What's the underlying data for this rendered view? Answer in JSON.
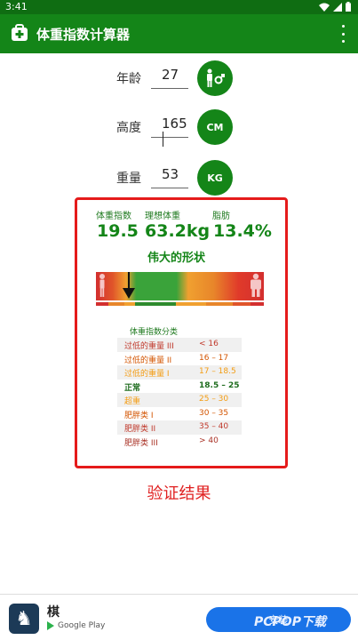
{
  "status_bar": {
    "time": "3:41"
  },
  "app_bar": {
    "title": "体重指数计算器"
  },
  "inputs": {
    "age": {
      "label": "年龄",
      "value": "27",
      "button_icon": "gender-icon"
    },
    "height": {
      "label": "高度",
      "value": "165",
      "unit": "CM"
    },
    "weight": {
      "label": "重量",
      "value": "53",
      "unit": "KG"
    }
  },
  "result": {
    "labels": {
      "bmi": "体重指数",
      "ideal": "理想体重",
      "fat": "脂肪"
    },
    "values": {
      "bmi": "19.5",
      "ideal": "63.2kg",
      "fat": "13.4%"
    },
    "subtitle": "伟大的形状",
    "category_title": "体重指数分类",
    "categories": [
      {
        "name": "过低的重量 III",
        "range": "< 16",
        "color": "#c0392b"
      },
      {
        "name": "过低的重量 II",
        "range": "16 – 17",
        "color": "#d35400"
      },
      {
        "name": "过低的重量 I",
        "range": "17 – 18.5",
        "color": "#f39c12"
      },
      {
        "name": "正常",
        "range": "18.5 – 25",
        "color": "#1f6d1f"
      },
      {
        "name": "超重",
        "range": "25 – 30",
        "color": "#f39c12"
      },
      {
        "name": "肥胖类 I",
        "range": "30 – 35",
        "color": "#d35400"
      },
      {
        "name": "肥胖类 II",
        "range": "35 – 40",
        "color": "#c0392b"
      },
      {
        "name": "肥胖类 III",
        "range": "> 40",
        "color": "#a93226"
      }
    ]
  },
  "caption": "验证结果",
  "ad": {
    "app_name": "棋",
    "icon_glyph": "♞",
    "store": "Google Play",
    "install_label": "安装",
    "watermark": "PCPOP下载"
  },
  "colors": {
    "primary": "#148518",
    "primary_dark": "#0f6d12",
    "highlight": "#e51b1b"
  }
}
